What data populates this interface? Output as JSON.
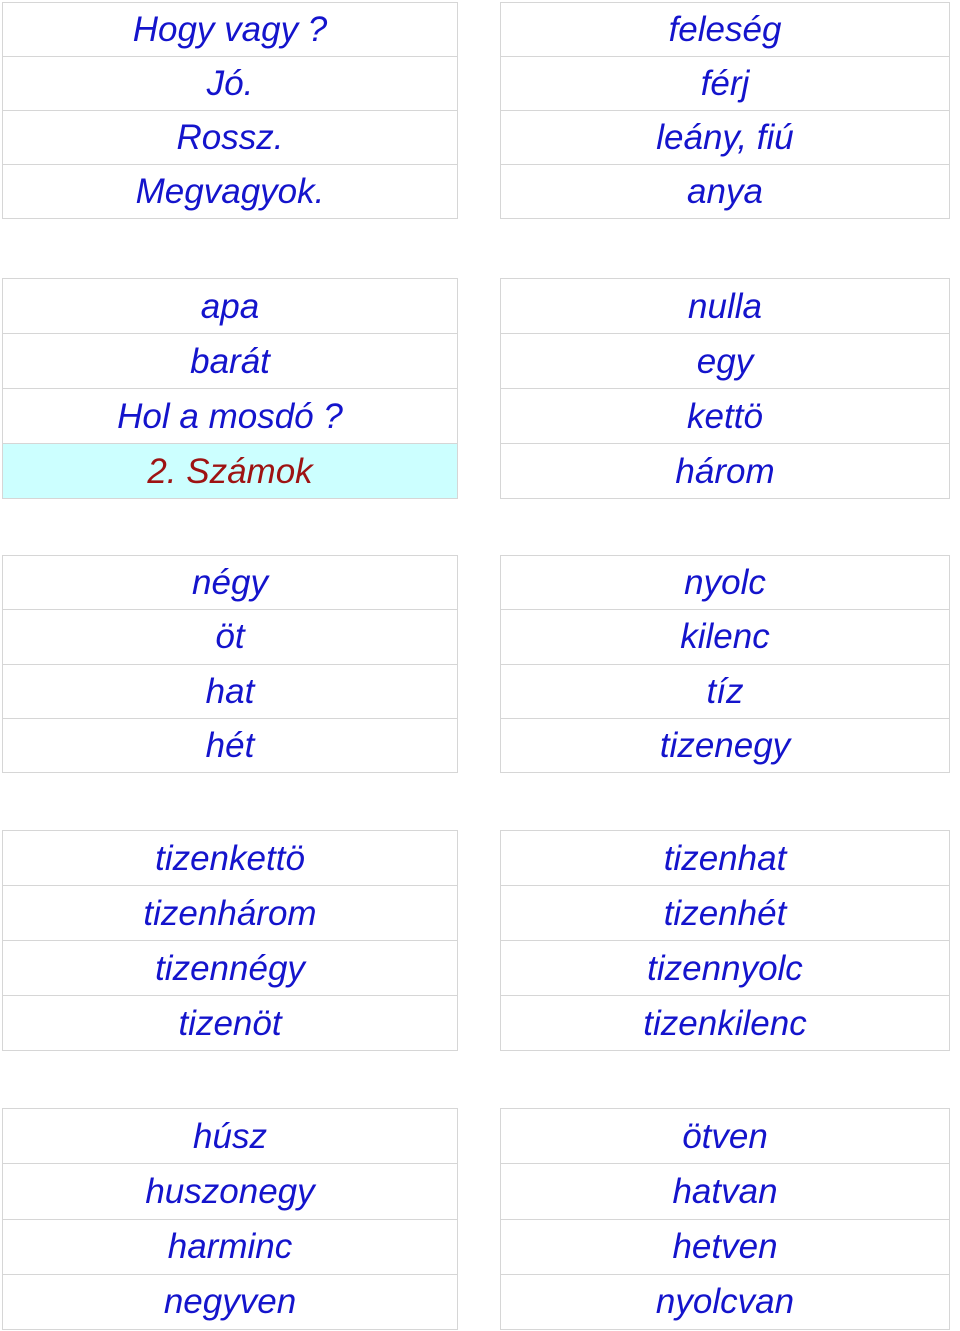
{
  "document": {
    "language": "Hungarian",
    "text_color": "#1414CC",
    "highlight_bg": "#CCFFFF",
    "highlight_text_color": "#9E1313",
    "border_color": "#D6D6D6"
  },
  "blocks": [
    {
      "id": "block1",
      "left": {
        "rows": [
          {
            "text": "Hogy vagy ?",
            "highlight": false
          },
          {
            "text": "Jó.",
            "highlight": false
          },
          {
            "text": "Rossz.",
            "highlight": false
          },
          {
            "text": "Megvagyok.",
            "highlight": false
          }
        ]
      },
      "right": {
        "rows": [
          {
            "text": "feleség",
            "highlight": false
          },
          {
            "text": "férj",
            "highlight": false
          },
          {
            "text": "leány, fiú",
            "highlight": false
          },
          {
            "text": "anya",
            "highlight": false
          }
        ]
      }
    },
    {
      "id": "block2",
      "left": {
        "rows": [
          {
            "text": "apa",
            "highlight": false
          },
          {
            "text": "barát",
            "highlight": false
          },
          {
            "text": "Hol a mosdó ?",
            "highlight": false
          },
          {
            "text": "2. Számok",
            "highlight": true
          }
        ]
      },
      "right": {
        "rows": [
          {
            "text": "nulla",
            "highlight": false
          },
          {
            "text": "egy",
            "highlight": false
          },
          {
            "text": "kettö",
            "highlight": false
          },
          {
            "text": "három",
            "highlight": false
          }
        ]
      }
    },
    {
      "id": "block3",
      "left": {
        "rows": [
          {
            "text": "négy",
            "highlight": false
          },
          {
            "text": "öt",
            "highlight": false
          },
          {
            "text": "hat",
            "highlight": false
          },
          {
            "text": "hét",
            "highlight": false
          }
        ]
      },
      "right": {
        "rows": [
          {
            "text": "nyolc",
            "highlight": false
          },
          {
            "text": "kilenc",
            "highlight": false
          },
          {
            "text": "tíz",
            "highlight": false
          },
          {
            "text": "tizenegy",
            "highlight": false
          }
        ]
      }
    },
    {
      "id": "block4",
      "left": {
        "rows": [
          {
            "text": "tizenkettö",
            "highlight": false
          },
          {
            "text": "tizenhárom",
            "highlight": false
          },
          {
            "text": "tizennégy",
            "highlight": false
          },
          {
            "text": "tizenöt",
            "highlight": false
          }
        ]
      },
      "right": {
        "rows": [
          {
            "text": "tizenhat",
            "highlight": false
          },
          {
            "text": "tizenhét",
            "highlight": false
          },
          {
            "text": "tizennyolc",
            "highlight": false
          },
          {
            "text": "tizenkilenc",
            "highlight": false
          }
        ]
      }
    },
    {
      "id": "block5",
      "left": {
        "rows": [
          {
            "text": "húsz",
            "highlight": false
          },
          {
            "text": "huszonegy",
            "highlight": false
          },
          {
            "text": "harminc",
            "highlight": false
          },
          {
            "text": "negyven",
            "highlight": false
          }
        ]
      },
      "right": {
        "rows": [
          {
            "text": "ötven",
            "highlight": false
          },
          {
            "text": "hatvan",
            "highlight": false
          },
          {
            "text": "hetven",
            "highlight": false
          },
          {
            "text": "nyolcvan",
            "highlight": false
          }
        ]
      }
    }
  ]
}
